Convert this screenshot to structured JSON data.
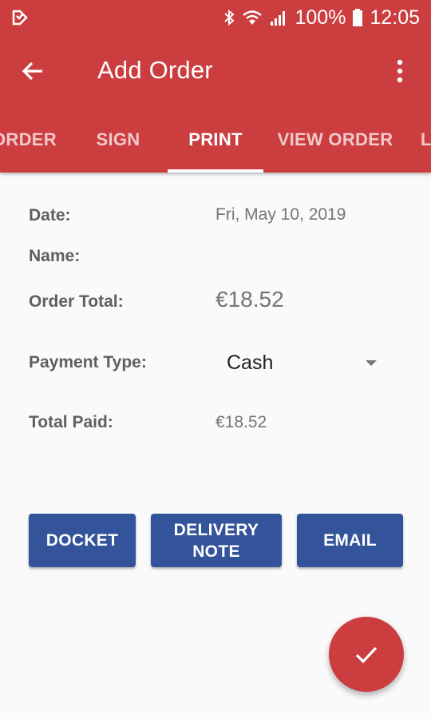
{
  "status_bar": {
    "battery_text": "100%",
    "time": "12:05"
  },
  "toolbar": {
    "title": "Add Order",
    "back_icon": "arrow-left-icon",
    "more_icon": "more-vertical-icon"
  },
  "tabs": [
    {
      "label": "ORDER",
      "active": false
    },
    {
      "label": "SIGN",
      "active": false
    },
    {
      "label": "PRINT",
      "active": true
    },
    {
      "label": "VIEW ORDER",
      "active": false
    },
    {
      "label": "L",
      "active": false
    }
  ],
  "form": {
    "date_label": "Date:",
    "date_value": "Fri, May 10, 2019",
    "name_label": "Name:",
    "order_total_label": "Order Total:",
    "order_total_value": "€18.52",
    "payment_type_label": "Payment Type:",
    "payment_type_value": "Cash",
    "total_paid_label": "Total Paid:",
    "total_paid_value": "€18.52"
  },
  "actions": {
    "docket_label": "DOCKET",
    "delivery_note_label": "DELIVERY\nNOTE",
    "email_label": "EMAIL"
  },
  "fab": {
    "icon": "check-icon"
  },
  "colors": {
    "primary": "#cc3d40",
    "button": "#33549a"
  }
}
